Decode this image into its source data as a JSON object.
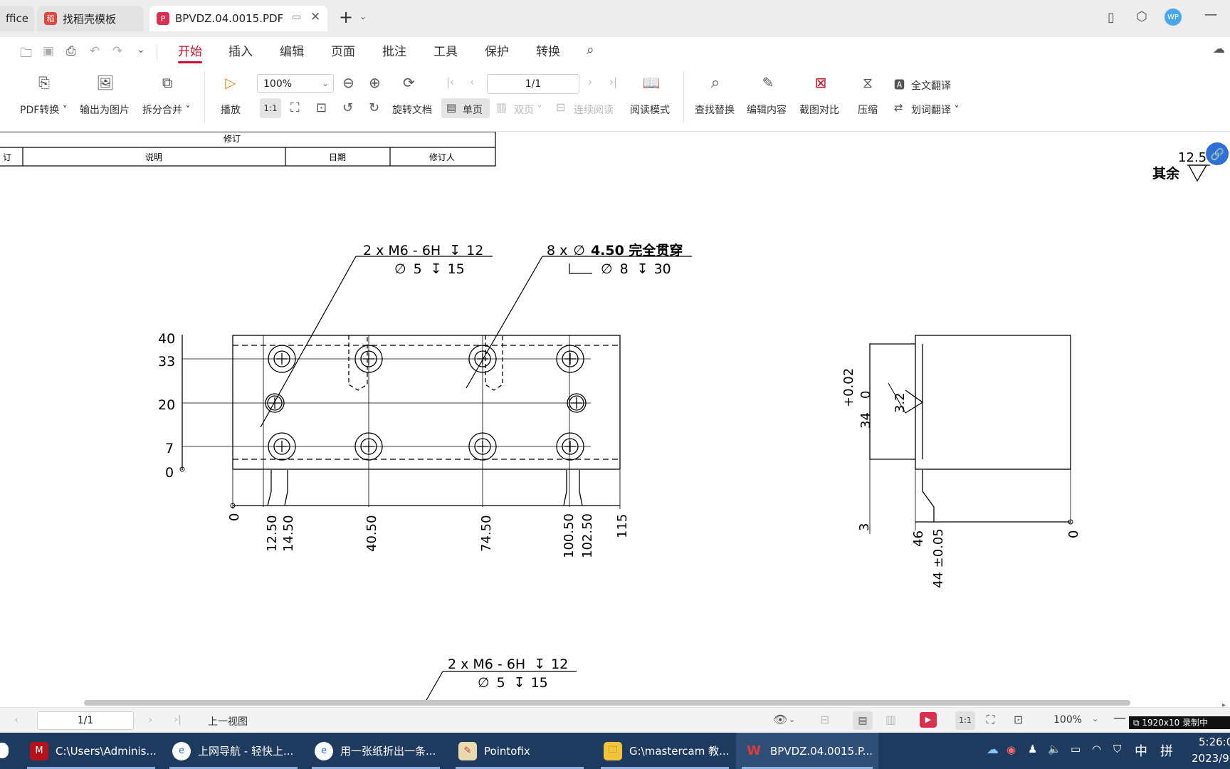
{
  "tabs": [
    {
      "label": "ffice"
    },
    {
      "label": "找稻壳模板"
    },
    {
      "label": "BPVDZ.04.0015.PDF"
    }
  ],
  "title_right": {
    "avatar": "WP"
  },
  "menu": [
    "开始",
    "插入",
    "编辑",
    "页面",
    "批注",
    "工具",
    "保护",
    "转换"
  ],
  "ribbon": {
    "pdf_convert": "PDF转换",
    "export_image": "输出为图片",
    "split_merge": "拆分合并",
    "play": "播放",
    "zoom": "100%",
    "page": "1/1",
    "rotate": "旋转文档",
    "single_page": "单页",
    "double_page": "双页",
    "continuous": "连续阅读",
    "read_mode": "阅读模式",
    "find_replace": "查找替换",
    "edit_content": "编辑内容",
    "screenshot_compare": "截图对比",
    "compress": "压缩",
    "full_translate": "全文翻译",
    "word_translate": "划词翻译",
    "actual_size": "1:1"
  },
  "drawing": {
    "rev_header": "修订",
    "rev_col1": "订",
    "rev_col2": "说明",
    "rev_col3": "日期",
    "rev_col4": "修订人",
    "rough_value": "12.5",
    "rough_label": "其余",
    "note1_line1": "2 x  M6 - 6H",
    "note1_depth": "12",
    "note1_line2": "5",
    "note1_line2_depth": "15",
    "note2_count": "8 x",
    "note2_dia": "4.50 完全贯穿",
    "note2_cb_dia": "8",
    "note2_cb_depth": "30",
    "y_dims": [
      "40",
      "33",
      "20",
      "7",
      "0"
    ],
    "x_dims": [
      "0",
      "12.50",
      "14.50",
      "40.50",
      "74.50",
      "100.50",
      "102.50",
      "115"
    ],
    "side_tol_top": "+0.02",
    "side_tol_bot": "0",
    "side_h": "34",
    "side_finish": "3.2",
    "side_dims": [
      "3",
      "46",
      "44 ±0.05",
      "0"
    ],
    "note3_line1": "2 x  M6 - 6H",
    "note3_depth": "12",
    "note3_line2": "5",
    "note3_line2_depth": "15"
  },
  "statusbar": {
    "page": "1/1",
    "prev_view": "上一视图",
    "zoom": "100%",
    "recording": "1920x10 录制中"
  },
  "taskbar": [
    {
      "label": "C:\\Users\\Adminis..."
    },
    {
      "label": "上网导航 - 轻快上..."
    },
    {
      "label": "用一张纸折出一条..."
    },
    {
      "label": "Pointofix"
    },
    {
      "label": "G:\\mastercam 教..."
    },
    {
      "label": "BPVDZ.04.0015.P..."
    }
  ],
  "tray": {
    "ime": "中",
    "ime2": "拼",
    "time": "5:26:0",
    "date": "2023/9"
  }
}
